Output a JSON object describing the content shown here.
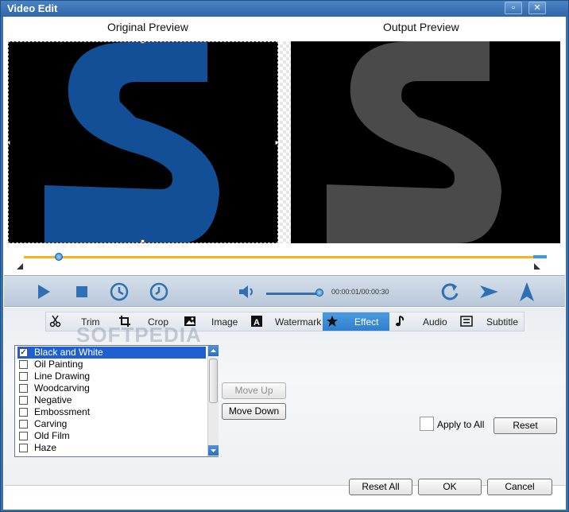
{
  "window": {
    "title": "Video Edit",
    "maximize_glyph": "▫",
    "close_glyph": "✕"
  },
  "preview": {
    "original_label": "Original Preview",
    "output_label": "Output Preview"
  },
  "playback": {
    "time": "00:00:01/00:00:30",
    "timeline_position": 0.07,
    "volume_level": 0.95
  },
  "tabs": [
    {
      "label": "Trim",
      "icon": "scissors-icon"
    },
    {
      "label": "Crop",
      "icon": "crop-icon"
    },
    {
      "label": "Image",
      "icon": "image-icon"
    },
    {
      "label": "Watermark",
      "icon": "watermark-icon"
    },
    {
      "label": "Effect",
      "icon": "star-icon",
      "active": true
    },
    {
      "label": "Audio",
      "icon": "music-note-icon"
    },
    {
      "label": "Subtitle",
      "icon": "subtitle-icon"
    }
  ],
  "effects": [
    {
      "label": "Black and White",
      "checked": true,
      "selected": true
    },
    {
      "label": "Oil Painting",
      "checked": false
    },
    {
      "label": "Line Drawing",
      "checked": false
    },
    {
      "label": "Woodcarving",
      "checked": false
    },
    {
      "label": "Negative",
      "checked": false
    },
    {
      "label": "Embossment",
      "checked": false
    },
    {
      "label": "Carving",
      "checked": false
    },
    {
      "label": "Old Film",
      "checked": false
    },
    {
      "label": "Haze",
      "checked": false
    }
  ],
  "effect_buttons": {
    "move_up": "Move Up",
    "move_down": "Move Down",
    "apply_to_all": "Apply to All",
    "reset": "Reset"
  },
  "footer": {
    "reset_all": "Reset All",
    "ok": "OK",
    "cancel": "Cancel"
  },
  "watermark_text": "SOFTPEDIA",
  "colors": {
    "accent": "#2f7fce",
    "logo_blue": "#134f96",
    "logo_gray": "#4a4a4a",
    "timeline": "#f2b51e"
  }
}
